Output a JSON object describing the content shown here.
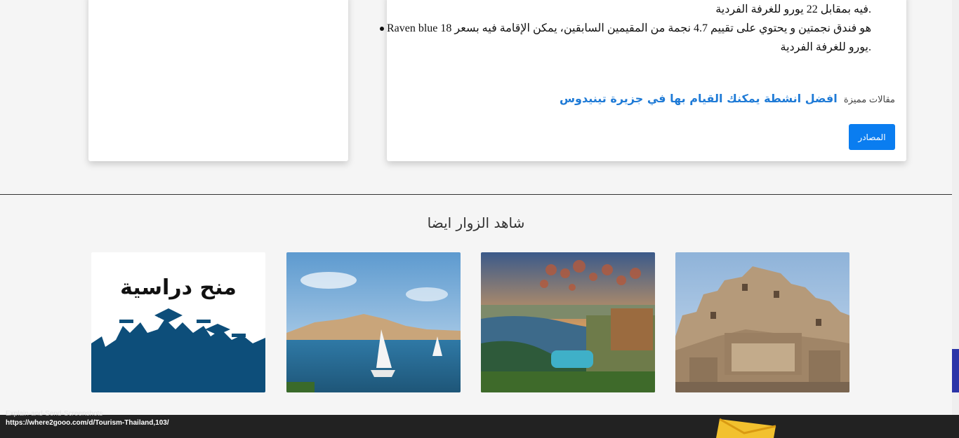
{
  "article": {
    "lines": [
      {
        "text": ".فيه بمقابل 22 يورو للغرفة الفردية",
        "bullet": false
      },
      {
        "text": "هو فندق نجمتين و يحتوي على تقييم 4.7 نجمة من المقيمين السابقين، يمكن الإقامة فيه بسعر  18  Raven blue",
        "bullet": true
      },
      {
        "text": ".يورو للغرفة الفردية",
        "bullet": false
      }
    ],
    "featured_label": "مقالات مميزة",
    "featured_link": "افضل انشطة يمكنك القيام بها في جزيرة تينيدوس",
    "sources_button": "المصادر"
  },
  "related": {
    "title": "شاهد الزوار ايضا",
    "items": [
      {
        "image": "siwa-fortress-image"
      },
      {
        "image": "aswan-nile-aerial-image"
      },
      {
        "image": "nile-felucca-image"
      },
      {
        "image": "scholarships-graphic-image",
        "overlay_text": "منح دراسية"
      }
    ]
  },
  "status_tooltip": {
    "line1": "Explain-and-Send-Screenshots",
    "line2": "https://where2gooo.com/d/Tourism-Thailand,103/"
  },
  "colors": {
    "link": "#1e7ad6",
    "button": "#0a7df0",
    "footer": "#222222",
    "scroll_thumb": "#2b34a8"
  }
}
